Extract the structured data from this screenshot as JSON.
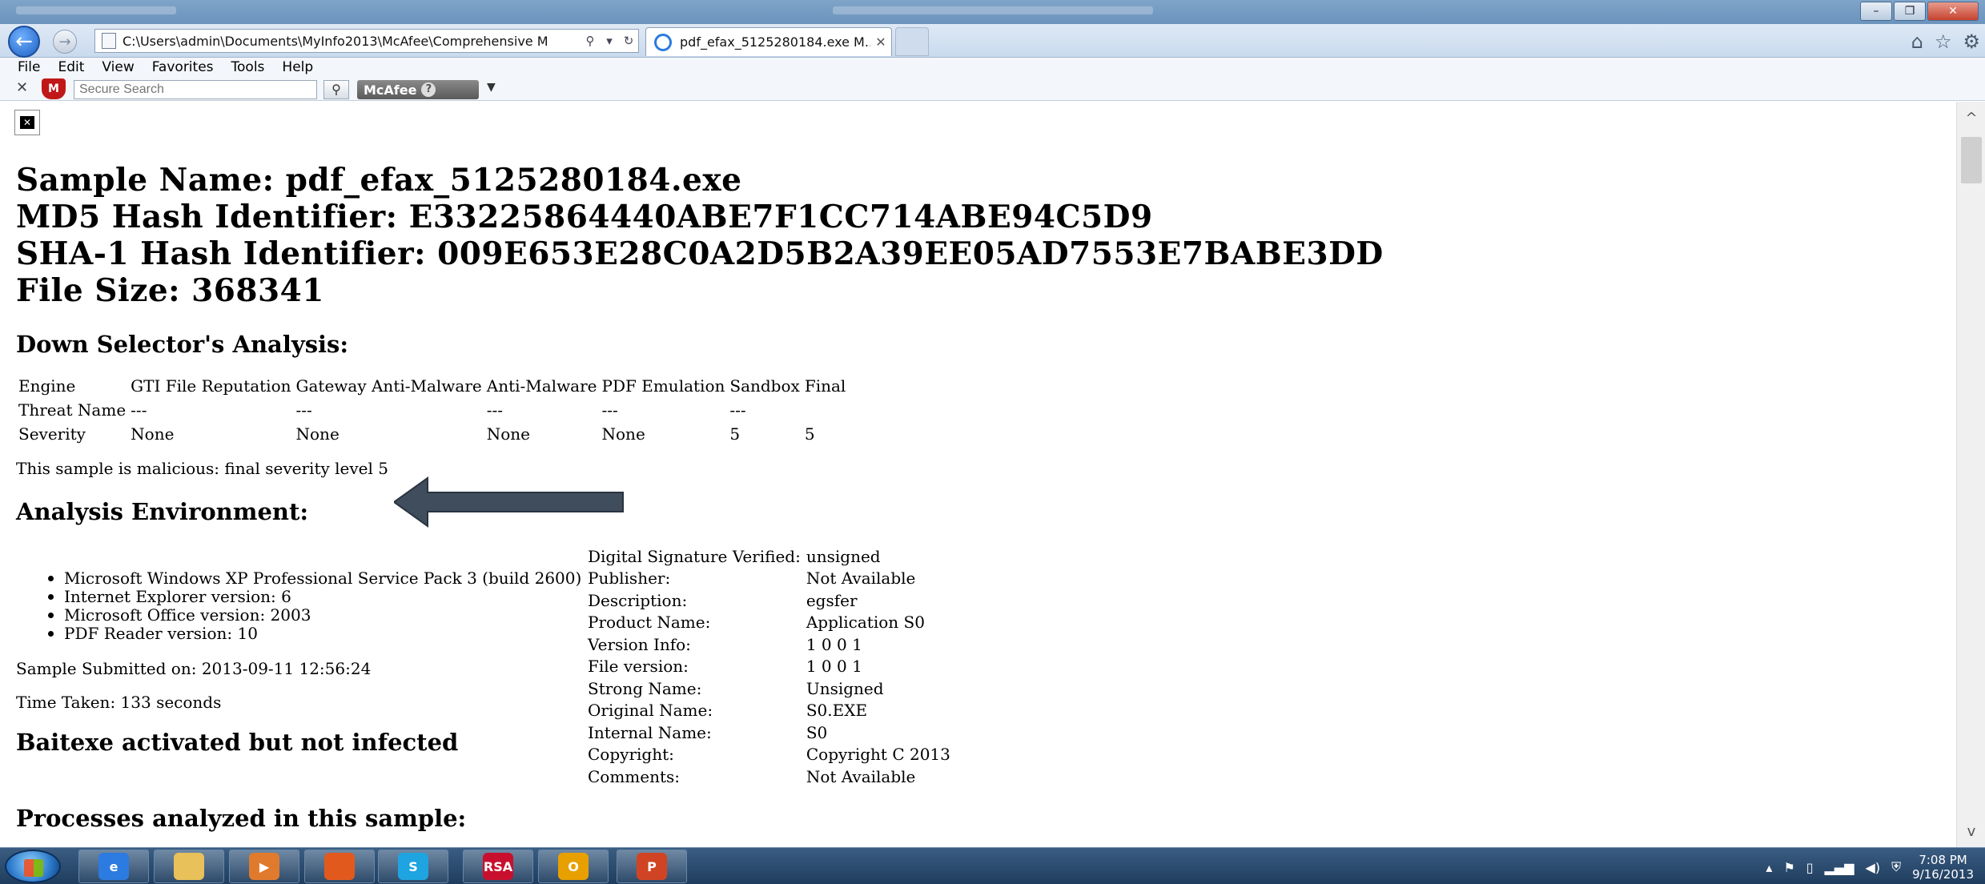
{
  "browser": {
    "address": "C:\\Users\\admin\\Documents\\MyInfo2013\\McAfee\\Comprehensive M",
    "tab_title": "pdf_efax_5125280184.exe M...",
    "menu": [
      "File",
      "Edit",
      "View",
      "Favorites",
      "Tools",
      "Help"
    ],
    "toolbar": {
      "search_placeholder": "Secure Search",
      "brand": "McAfee",
      "help": "?"
    }
  },
  "report": {
    "sample_name": "Sample Name: pdf_efax_5125280184.exe",
    "md5": "MD5 Hash Identifier: E33225864440ABE7F1CC714ABE94C5D9",
    "sha1": "SHA-1 Hash Identifier: 009E653E28C0A2D5B2A39EE05AD7553E7BABE3DD",
    "file_size": "File Size: 368341",
    "down_selector_heading": "Down Selector's Analysis:",
    "selector_table": {
      "headers": [
        "Engine",
        "GTI File Reputation",
        "Gateway Anti-Malware",
        "Anti-Malware",
        "PDF Emulation",
        "Sandbox",
        "Final"
      ],
      "rows": [
        [
          "Threat Name",
          "---",
          "---",
          "---",
          "---",
          "---",
          ""
        ],
        [
          "Severity",
          "None",
          "None",
          "None",
          "None",
          "5",
          "5"
        ]
      ]
    },
    "verdict": "This sample is malicious: final severity level 5",
    "env_heading": "Analysis Environment:",
    "environment": [
      "Microsoft Windows XP Professional Service Pack 3 (build 2600)",
      "Internet Explorer version: 6",
      "Microsoft Office version: 2003",
      "PDF Reader version: 10"
    ],
    "submitted": "Sample Submitted on: 2013-09-11 12:56:24",
    "time_taken": "Time Taken: 133 seconds",
    "baitexe": "Baitexe activated but not infected",
    "processes_heading": "Processes analyzed in this sample:",
    "signature": [
      {
        "key": "Digital Signature Verified:",
        "value": "unsigned"
      },
      {
        "key": "Publisher:",
        "value": "Not Available"
      },
      {
        "key": "Description:",
        "value": "egsfer"
      },
      {
        "key": "Product Name:",
        "value": "Application S0"
      },
      {
        "key": "Version Info:",
        "value": "1 0 0 1"
      },
      {
        "key": "File version:",
        "value": "1 0 0 1"
      },
      {
        "key": "Strong Name:",
        "value": "Unsigned"
      },
      {
        "key": "Original Name:",
        "value": "S0.EXE"
      },
      {
        "key": "Internal Name:",
        "value": "S0"
      },
      {
        "key": "Copyright:",
        "value": "Copyright C 2013"
      },
      {
        "key": "Comments:",
        "value": "Not Available"
      }
    ]
  },
  "taskbar": {
    "apps": [
      {
        "name": "internet-explorer-icon",
        "glyph": "e",
        "color": "#2c7be0"
      },
      {
        "name": "file-explorer-icon",
        "glyph": "",
        "color": "#e8c15a"
      },
      {
        "name": "media-player-icon",
        "glyph": "▶",
        "color": "#e07a2c"
      },
      {
        "name": "firefox-icon",
        "glyph": "",
        "color": "#e2591d"
      },
      {
        "name": "skype-icon",
        "glyph": "S",
        "color": "#1ea4e0"
      },
      {
        "name": "rsa-icon",
        "glyph": "RSA",
        "color": "#c8102e"
      },
      {
        "name": "outlook-icon",
        "glyph": "O",
        "color": "#e8a000"
      },
      {
        "name": "powerpoint-icon",
        "glyph": "P",
        "color": "#d04423"
      }
    ],
    "time": "7:08 PM",
    "date": "9/16/2013"
  }
}
